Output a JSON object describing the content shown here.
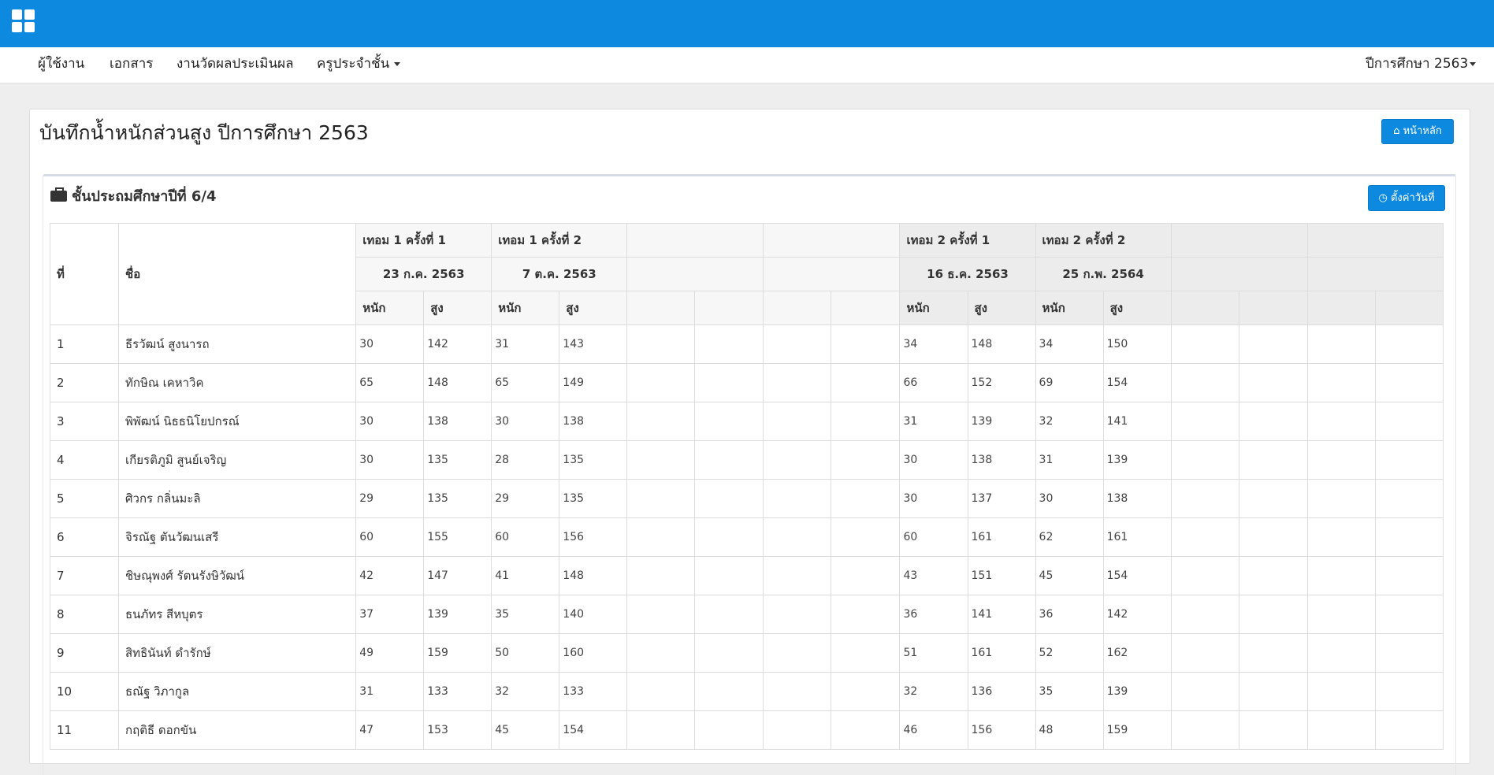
{
  "nav": {
    "items": [
      "ผู้ใช้งาน",
      "เอกสาร",
      "งานวัดผลประเมินผล",
      "ครูประจำชั้น"
    ],
    "year_menu": "ปีการศึกษา 2563"
  },
  "page": {
    "title": "บันทึกน้ำหนักส่วนสูง ปีการศึกษา 2563",
    "home_button": "หน้าหลัก"
  },
  "section": {
    "title": "ชั้นประถมศึกษาปีที่ 6/4",
    "set_date_button": "ตั้งค่าวันที่"
  },
  "table": {
    "col_no": "ที่",
    "col_name": "ชื่อ",
    "weight_label": "หนัก",
    "height_label": "สูง",
    "rounds": [
      {
        "label": "เทอม 1 ครั้งที่ 1",
        "date": "23 ก.ค. 2563"
      },
      {
        "label": "เทอม 1 ครั้งที่ 2",
        "date": "7 ต.ค. 2563"
      },
      {
        "label": "",
        "date": ""
      },
      {
        "label": "",
        "date": ""
      },
      {
        "label": "เทอม 2 ครั้งที่ 1",
        "date": "16 ธ.ค. 2563"
      },
      {
        "label": "เทอม 2 ครั้งที่ 2",
        "date": "25 ก.พ. 2564"
      },
      {
        "label": "",
        "date": ""
      },
      {
        "label": "",
        "date": ""
      }
    ],
    "rows": [
      {
        "no": "1",
        "name": "ธีรวัฒน์ สูงนารถ",
        "vals": [
          "30",
          "142",
          "31",
          "143",
          "",
          "",
          "",
          "",
          "34",
          "148",
          "34",
          "150",
          "",
          "",
          "",
          ""
        ]
      },
      {
        "no": "2",
        "name": "ทักษิณ เคหาวิค",
        "vals": [
          "65",
          "148",
          "65",
          "149",
          "",
          "",
          "",
          "",
          "66",
          "152",
          "69",
          "154",
          "",
          "",
          "",
          ""
        ]
      },
      {
        "no": "3",
        "name": "พิพัฒน์ นิธธนิโยปกรณ์",
        "vals": [
          "30",
          "138",
          "30",
          "138",
          "",
          "",
          "",
          "",
          "31",
          "139",
          "32",
          "141",
          "",
          "",
          "",
          ""
        ]
      },
      {
        "no": "4",
        "name": "เกียรติภูมิ สูนย์เจริญ",
        "vals": [
          "30",
          "135",
          "28",
          "135",
          "",
          "",
          "",
          "",
          "30",
          "138",
          "31",
          "139",
          "",
          "",
          "",
          ""
        ]
      },
      {
        "no": "5",
        "name": "ศิวกร กลิ่นมะลิ",
        "vals": [
          "29",
          "135",
          "29",
          "135",
          "",
          "",
          "",
          "",
          "30",
          "137",
          "30",
          "138",
          "",
          "",
          "",
          ""
        ]
      },
      {
        "no": "6",
        "name": "จิรณัฐ ตันวัฒนเสรี",
        "vals": [
          "60",
          "155",
          "60",
          "156",
          "",
          "",
          "",
          "",
          "60",
          "161",
          "62",
          "161",
          "",
          "",
          "",
          ""
        ]
      },
      {
        "no": "7",
        "name": "ชิษณุพงศ์ รัตนรังษิวัฒน์",
        "vals": [
          "42",
          "147",
          "41",
          "148",
          "",
          "",
          "",
          "",
          "43",
          "151",
          "45",
          "154",
          "",
          "",
          "",
          ""
        ]
      },
      {
        "no": "8",
        "name": "ธนภัทร สีหบุตร",
        "vals": [
          "37",
          "139",
          "35",
          "140",
          "",
          "",
          "",
          "",
          "36",
          "141",
          "36",
          "142",
          "",
          "",
          "",
          ""
        ]
      },
      {
        "no": "9",
        "name": "สิทธินันท์ ดำรักษ์",
        "vals": [
          "49",
          "159",
          "50",
          "160",
          "",
          "",
          "",
          "",
          "51",
          "161",
          "52",
          "162",
          "",
          "",
          "",
          ""
        ]
      },
      {
        "no": "10",
        "name": "ธณัฐ วิภากูล",
        "vals": [
          "31",
          "133",
          "32",
          "133",
          "",
          "",
          "",
          "",
          "32",
          "136",
          "35",
          "139",
          "",
          "",
          "",
          ""
        ]
      },
      {
        "no": "11",
        "name": "กฤติธี ดอกขัน",
        "vals": [
          "47",
          "153",
          "45",
          "154",
          "",
          "",
          "",
          "",
          "46",
          "156",
          "48",
          "159",
          "",
          "",
          "",
          ""
        ]
      }
    ]
  }
}
